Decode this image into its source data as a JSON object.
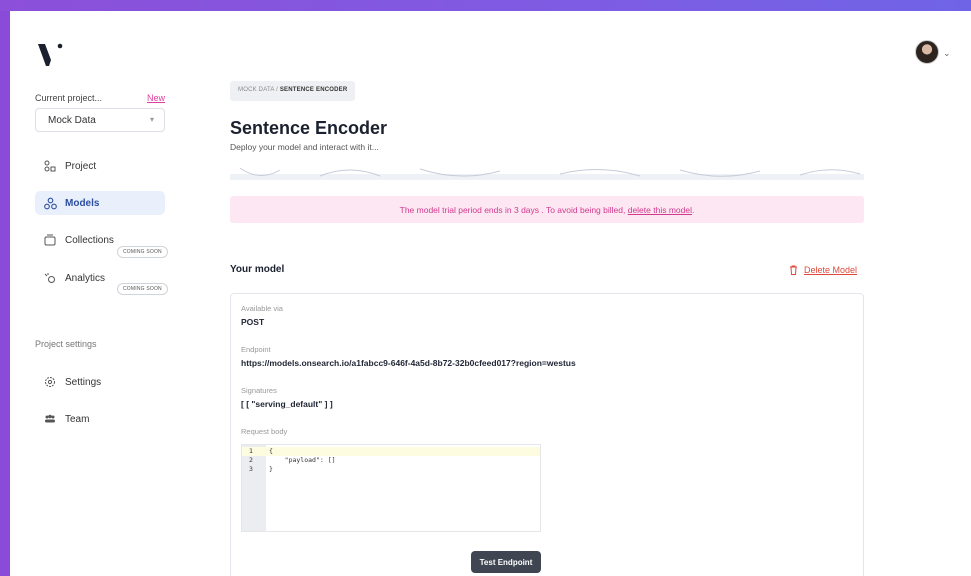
{
  "sidebar": {
    "current_project_label": "Current project...",
    "new_link": "New",
    "project_select_value": "Mock Data",
    "nav": [
      {
        "label": "Project",
        "icon": "project-icon"
      },
      {
        "label": "Models",
        "icon": "models-icon",
        "active": true
      },
      {
        "label": "Collections",
        "icon": "collections-icon",
        "badge": "COMING SOON"
      },
      {
        "label": "Analytics",
        "icon": "analytics-icon",
        "badge": "COMING SOON"
      }
    ],
    "project_settings_label": "Project settings",
    "settings_nav": [
      {
        "label": "Settings",
        "icon": "gear-icon"
      },
      {
        "label": "Team",
        "icon": "team-icon"
      }
    ]
  },
  "breadcrumb": {
    "parent": "MOCK DATA",
    "separator": " / ",
    "current": "SENTENCE ENCODER"
  },
  "page": {
    "title": "Sentence Encoder",
    "subtitle": "Deploy your model and interact with it..."
  },
  "banner": {
    "text": "The model trial period ends in 3 days . To avoid being billed, ",
    "link": "delete this model",
    "suffix": "."
  },
  "your_model": {
    "heading": "Your model",
    "delete_label": "Delete Model",
    "available_via_label": "Available via",
    "available_via_value": "POST",
    "endpoint_label": "Endpoint",
    "endpoint_value": "https://models.onsearch.io/a1fabcc9-646f-4a5d-8b72-32b0cfeed017?region=westus",
    "signatures_label": "Signatures",
    "signatures_value": "[ [ \"serving_default\" ] ]",
    "request_body_label": "Request body",
    "code_lines": [
      {
        "num": "1",
        "text": "{"
      },
      {
        "num": "2",
        "text": "    \"payload\": []"
      },
      {
        "num": "3",
        "text": "}"
      }
    ],
    "test_button": "Test Endpoint"
  },
  "colors": {
    "accent": "#e040a0",
    "active_nav_bg": "#eaf0fb",
    "banner_bg": "#fde7f3",
    "danger": "#e0483b"
  }
}
